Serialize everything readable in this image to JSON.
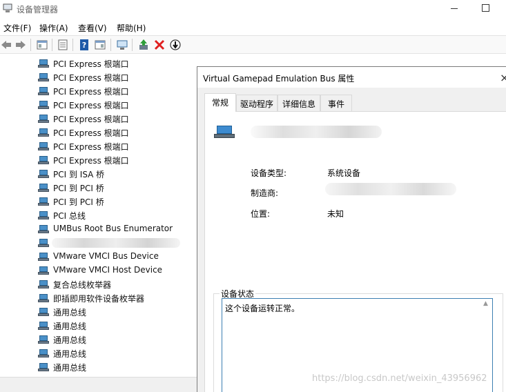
{
  "window": {
    "title": "设备管理器"
  },
  "menu": [
    "文件(F)",
    "操作(A)",
    "查看(V)",
    "帮助(H)"
  ],
  "toolbar": {
    "icons": [
      "back-arrow-icon",
      "forward-arrow-icon",
      "properties-icon",
      "console-tree-icon",
      "help-icon",
      "action-pane-icon",
      "scan-hardware-icon",
      "update-driver-icon",
      "uninstall-icon",
      "disable-device-icon"
    ]
  },
  "tree": {
    "items": [
      "PCI Express 根端口",
      "PCI Express 根端口",
      "PCI Express 根端口",
      "PCI Express 根端口",
      "PCI Express 根端口",
      "PCI Express 根端口",
      "PCI Express 根端口",
      "PCI Express 根端口",
      "PCI 到 ISA 桥",
      "PCI 到 PCI 桥",
      "PCI 到 PCI 桥",
      "PCI 总线",
      "UMBus Root Bus Enumerator",
      "",
      "VMware VMCI Bus Device",
      "VMware VMCI Host Device",
      "复合总线枚举器",
      "即插即用软件设备枚举器",
      "通用总线",
      "通用总线",
      "通用总线",
      "通用总线",
      "通用总线"
    ]
  },
  "dialog": {
    "title": "Virtual Gamepad Emulation Bus 属性",
    "close_glyph": "×",
    "tabs": [
      "常规",
      "驱动程序",
      "详细信息",
      "事件"
    ],
    "active_tab": "常规",
    "properties": {
      "type_label": "设备类型:",
      "type_value": "系统设备",
      "manufacturer_label": "制造商:",
      "location_label": "位置:",
      "location_value": "未知"
    },
    "status_group_label": "设备状态",
    "status_text": "这个设备运转正常。"
  },
  "watermark": "https://blog.csdn.net/weixin_43956962",
  "colors": {
    "accent_border": "#3c7fb1",
    "error_red": "#e02020",
    "help_blue": "#1e5aa8"
  }
}
